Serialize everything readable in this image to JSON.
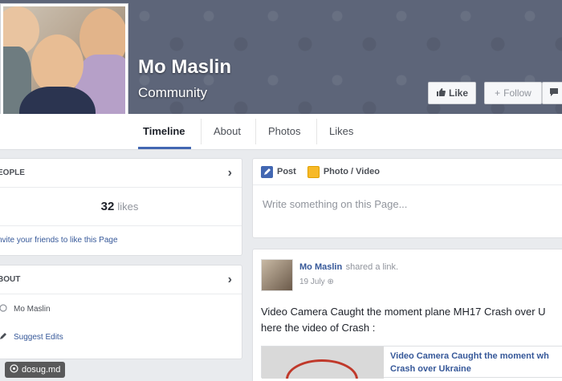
{
  "page": {
    "name": "Mo Maslin",
    "category": "Community"
  },
  "actions": {
    "like_label": "Like",
    "follow_label": "Follow"
  },
  "tabs": [
    {
      "label": "Timeline"
    },
    {
      "label": "About"
    },
    {
      "label": "Photos"
    },
    {
      "label": "Likes"
    }
  ],
  "people_card": {
    "header": "EOPLE",
    "likes_count": "32",
    "likes_word": "likes",
    "invite_text": "nvite your friends to like this Page"
  },
  "about_card": {
    "header": "BOUT",
    "name_row": "Mo Maslin",
    "suggest_edits": "Suggest Edits"
  },
  "composer": {
    "post_tab": "Post",
    "photo_tab": "Photo / Video",
    "placeholder": "Write something on this Page..."
  },
  "post": {
    "author": "Mo Maslin",
    "action": "shared a link.",
    "date": "19 July",
    "text_line1": "Video Camera Caught the moment plane MH17 Crash over U",
    "text_line2": "here the video of Crash :",
    "link_title_line1": "Video Camera Caught the moment wh",
    "link_title_line2": "Crash over Ukraine"
  },
  "watermark": "dosug.md",
  "colors": {
    "cover": "#5d6579",
    "accent": "#4267b2",
    "link": "#365899"
  }
}
